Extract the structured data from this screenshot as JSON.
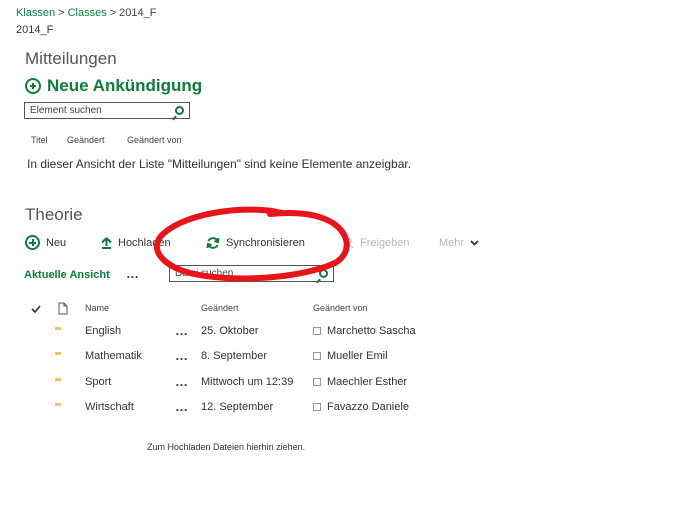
{
  "breadcrumb": {
    "items": [
      "Klassen",
      "Classes",
      "2014_F"
    ],
    "separator": ">"
  },
  "page_title": "2014_F",
  "announcements": {
    "title": "Mitteilungen",
    "new_label": "Neue Ankündigung",
    "search_placeholder": "Element suchen",
    "columns": [
      "Titel",
      "Geändert",
      "Geändert von"
    ],
    "empty_message": "In dieser Ansicht der Liste \"Mitteilungen\" sind keine Elemente anzeigbar."
  },
  "library": {
    "title": "Theorie",
    "toolbar": {
      "new": "Neu",
      "upload": "Hochladen",
      "sync": "Synchronisieren",
      "share": "Freigeben",
      "more": "Mehr"
    },
    "current_view": "Aktuelle Ansicht",
    "search_placeholder": "Datei suchen",
    "columns": {
      "name": "Name",
      "modified": "Geändert",
      "modified_by": "Geändert von"
    },
    "rows": [
      {
        "name": "English",
        "modified": "25. Oktober",
        "modified_by": "Marchetto Sascha"
      },
      {
        "name": "Mathematik",
        "modified": "8. September",
        "modified_by": "Mueller Emil"
      },
      {
        "name": "Sport",
        "modified": "Mittwoch um 12:39",
        "modified_by": "Maechler Esther"
      },
      {
        "name": "Wirtschaft",
        "modified": "12. September",
        "modified_by": "Favazzo Daniele"
      }
    ],
    "drop_hint": "Zum Hochladen Dateien hierhin ziehen."
  },
  "colors": {
    "accent": "#0f7b3c",
    "annotation": "#e8141c",
    "folder": "#f0c26a"
  },
  "icons": [
    "plus-circle-icon",
    "search-icon",
    "upload-arrow-icon",
    "sync-icon",
    "share-icon",
    "chevron-down-icon",
    "checkmark-icon",
    "document-icon",
    "folder-icon"
  ]
}
